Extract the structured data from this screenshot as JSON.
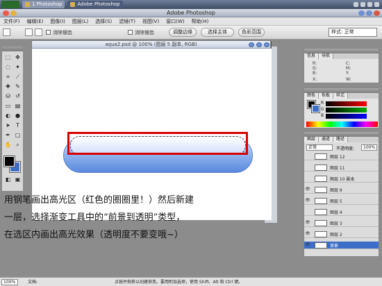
{
  "taskbar": {
    "tasks": [
      "1 Photoshop",
      "Adobe Photoshop"
    ],
    "active_index": 1
  },
  "app": {
    "title": "Adobe Photoshop"
  },
  "menubar": {
    "items": [
      "文件(F)",
      "编辑(E)",
      "图像(I)",
      "图层(L)",
      "选择(S)",
      "滤镜(T)",
      "视图(V)",
      "窗口(W)",
      "帮助(H)"
    ]
  },
  "options": {
    "buttons": [
      "调整边缘",
      "选择主体",
      "色彩范围"
    ],
    "checkbox_label": "消除锯齿",
    "brushes_field": "样式: 正常"
  },
  "document": {
    "title": "aqua2.psd @ 100% (图层 5 副本, RGB)"
  },
  "info_panel": {
    "tabs": [
      "信息",
      "导航"
    ],
    "labels": [
      "R:",
      "G:",
      "B:",
      "X:",
      "Y:",
      "C:",
      "M:",
      "Y:",
      "K:",
      "W:",
      "H:"
    ]
  },
  "color_panel": {
    "tabs": [
      "颜色",
      "色板",
      "样式"
    ],
    "channels": [
      "R",
      "G",
      "B"
    ],
    "values": [
      192,
      192,
      192
    ]
  },
  "layers_panel": {
    "tabs": [
      "图层",
      "通道",
      "路径"
    ],
    "mode": "正常",
    "opacity_label": "不透明度:",
    "opacity_value": "100%",
    "layers": [
      {
        "name": "图层 12",
        "visible": false,
        "selected": false
      },
      {
        "name": "图层 11",
        "visible": false,
        "selected": false
      },
      {
        "name": "图层 10 副本",
        "visible": false,
        "selected": false
      },
      {
        "name": "图层 9",
        "visible": true,
        "selected": false
      },
      {
        "name": "图层 5",
        "visible": true,
        "selected": false
      },
      {
        "name": "图层 4",
        "visible": false,
        "selected": false
      },
      {
        "name": "图层 3",
        "visible": true,
        "selected": false
      },
      {
        "name": "图层 2",
        "visible": true,
        "selected": false
      },
      {
        "name": "背景",
        "visible": true,
        "selected": true
      }
    ]
  },
  "note": {
    "line1": "用钢笔画出高光区（红色的圈圈里！）然后新建",
    "line2": "一层，选择渐变工具中的“前景到透明”类型，",
    "line3": "在选区内画出高光效果（透明度不要变哦~）"
  },
  "statusbar": {
    "zoom": "100%",
    "doc": "文档:",
    "hint": "点按并拖移以创建渐变。要用附加选项，使用 Shift、Alt 和 Ctrl 键。"
  },
  "colors": {
    "accent": "#d90000",
    "pill": "#5a88dd",
    "background_color": "#3f6fc4"
  }
}
